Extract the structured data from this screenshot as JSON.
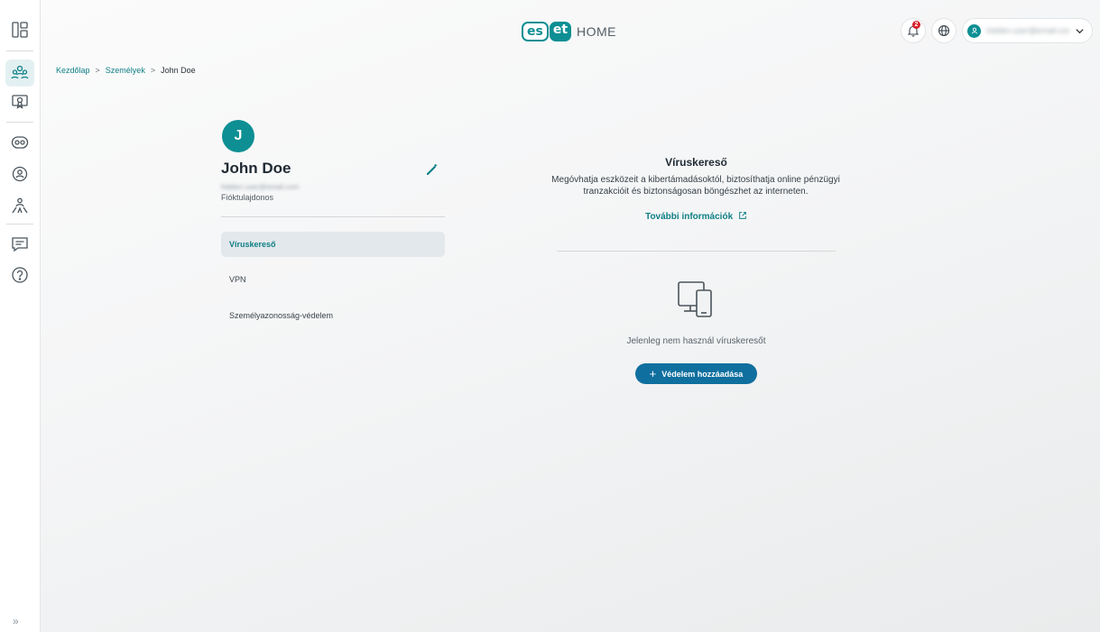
{
  "sidebar": {
    "items": [
      {
        "id": "dashboard",
        "icon": "dashboard-icon"
      },
      {
        "id": "people",
        "icon": "people-icon",
        "active": true
      },
      {
        "id": "licenses",
        "icon": "license-icon"
      },
      {
        "id": "devices",
        "icon": "devices-icon"
      },
      {
        "id": "security",
        "icon": "security-icon"
      },
      {
        "id": "family",
        "icon": "family-icon"
      },
      {
        "id": "feedback",
        "icon": "feedback-icon"
      },
      {
        "id": "help",
        "icon": "help-icon"
      }
    ],
    "expand_label": "»"
  },
  "header": {
    "logo_left": "es",
    "logo_right": "et",
    "logo_suffix": "HOME",
    "notification_count": "2",
    "account_email": "hidden.user@email.com"
  },
  "breadcrumb": {
    "home": "Kezdőlap",
    "people": "Személyek",
    "current": "John Doe",
    "separator": ">"
  },
  "profile": {
    "initial": "J",
    "name": "John Doe",
    "email": "hidden.user@email.com",
    "role": "Fióktulajdonos"
  },
  "menu": {
    "items": [
      {
        "label": "Víruskereső",
        "active": true
      },
      {
        "label": "VPN",
        "active": false
      },
      {
        "label": "Személyazonosság-védelem",
        "active": false
      }
    ]
  },
  "panel": {
    "title": "Víruskereső",
    "description": "Megóvhatja eszközeit a kibertámadásoktól, biztosíthatja online pénzügyi tranzakcióit és biztonságosan böngészhet az interneten.",
    "more_info": "További információk",
    "empty_text": "Jelenleg nem használ víruskeresőt",
    "add_button": "Védelem hozzáadása"
  },
  "colors": {
    "accent": "#0d8f93",
    "button": "#0f6f9e",
    "badge": "#d8202b"
  }
}
